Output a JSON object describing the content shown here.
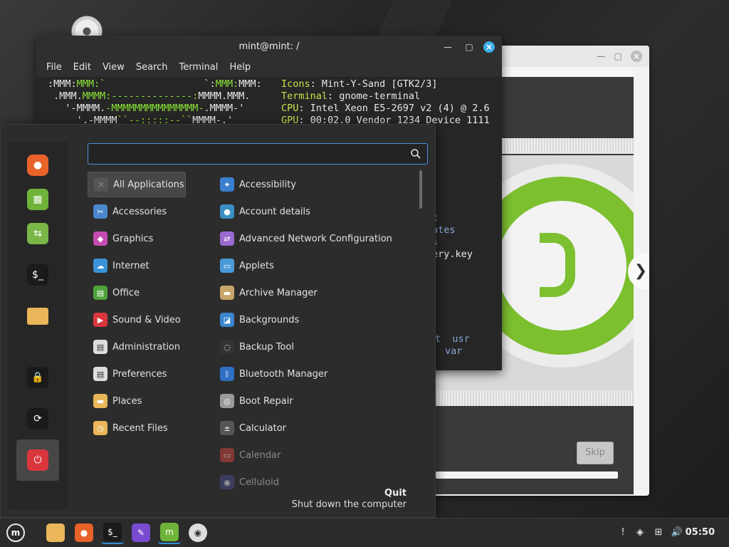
{
  "terminal": {
    "title": "mint@mint: /",
    "menu": [
      "File",
      "Edit",
      "View",
      "Search",
      "Terminal",
      "Help"
    ],
    "lines": [
      {
        "segments": [
          {
            "t": ":MMM:",
            "c": "w"
          },
          {
            "t": "MMM:`",
            "c": "g"
          },
          {
            "t": "                 `:",
            "c": "w"
          },
          {
            "t": "MMM:",
            "c": "g"
          },
          {
            "t": "MMM:",
            "c": "w"
          }
        ]
      },
      {
        "segments": [
          {
            "t": " .MMM.",
            "c": "w"
          },
          {
            "t": "MMMM:--------------:",
            "c": "g"
          },
          {
            "t": "MMMM.MMM.",
            "c": "w"
          }
        ]
      },
      {
        "segments": [
          {
            "t": "   '-MMMM.",
            "c": "w"
          },
          {
            "t": "-MMMMMMMMMMMMMMM-",
            "c": "g"
          },
          {
            "t": ".MMMM-'",
            "c": "w"
          }
        ]
      },
      {
        "segments": [
          {
            "t": "     '.-MMMM",
            "c": "w"
          },
          {
            "t": "``--:::::--``",
            "c": "g"
          },
          {
            "t": "MMMM-.'",
            "c": "w"
          }
        ]
      }
    ],
    "info": [
      {
        "key": "Icons",
        "value": " Mint-Y-Sand [GTK2/3]"
      },
      {
        "key": "Terminal",
        "value": " gnome-terminal"
      },
      {
        "key": "CPU",
        "value": " Intel Xeon E5-2697 v2 (4) @ 2.6"
      },
      {
        "key": "GPU",
        "value": " 00:02.0 Vendor 1234 Device 1111"
      }
    ],
    "fragments": [
      "c",
      "ates",
      "s",
      "ery.key",
      "t  usr",
      "var"
    ]
  },
  "installer": {
    "skip_label": "Skip",
    "next_glyph": "❯"
  },
  "menu": {
    "search_value": "",
    "favorites": [
      {
        "name": "firefox-icon",
        "color": "#e8622a"
      },
      {
        "name": "software-manager-icon",
        "color": "#6fb33a"
      },
      {
        "name": "system-settings-icon",
        "color": "#7ab648"
      },
      {
        "name": "terminal-icon",
        "color": "#1a1a1a"
      },
      {
        "name": "files-icon",
        "color": "#e9b65a"
      },
      {
        "name": "lock-screen-icon",
        "color": "#1a1a1a"
      },
      {
        "name": "logout-icon",
        "color": "#1a1a1a"
      },
      {
        "name": "quit-icon",
        "color": "#d9363e"
      }
    ],
    "categories": [
      {
        "label": "All Applications",
        "icon": "grid-icon",
        "color": "#555555"
      },
      {
        "label": "Accessories",
        "icon": "accessories-icon",
        "color": "#4c86cc"
      },
      {
        "label": "Graphics",
        "icon": "graphics-icon",
        "color": "#c44bb0"
      },
      {
        "label": "Internet",
        "icon": "internet-icon",
        "color": "#3a93d8"
      },
      {
        "label": "Office",
        "icon": "office-icon",
        "color": "#4fa23a"
      },
      {
        "label": "Sound & Video",
        "icon": "sound-video-icon",
        "color": "#d9363e"
      },
      {
        "label": "Administration",
        "icon": "administration-icon",
        "color": "#dddddd"
      },
      {
        "label": "Preferences",
        "icon": "preferences-icon",
        "color": "#dddddd"
      },
      {
        "label": "Places",
        "icon": "places-icon",
        "color": "#e9b65a"
      },
      {
        "label": "Recent Files",
        "icon": "recent-files-icon",
        "color": "#e9b65a"
      }
    ],
    "apps": [
      {
        "label": "Accessibility",
        "icon": "accessibility-icon",
        "color": "#3a7fd0"
      },
      {
        "label": "Account details",
        "icon": "account-details-icon",
        "color": "#3a8ec2"
      },
      {
        "label": "Advanced Network Configuration",
        "icon": "network-config-icon",
        "color": "#9b6ad0"
      },
      {
        "label": "Applets",
        "icon": "applets-icon",
        "color": "#4a9ad8"
      },
      {
        "label": "Archive Manager",
        "icon": "archive-manager-icon",
        "color": "#c7a56a"
      },
      {
        "label": "Backgrounds",
        "icon": "backgrounds-icon",
        "color": "#3c86d0"
      },
      {
        "label": "Backup Tool",
        "icon": "backup-tool-icon",
        "color": "#333333"
      },
      {
        "label": "Bluetooth Manager",
        "icon": "bluetooth-icon",
        "color": "#2f6fc4"
      },
      {
        "label": "Boot Repair",
        "icon": "boot-repair-icon",
        "color": "#9a9a9a"
      },
      {
        "label": "Calculator",
        "icon": "calculator-icon",
        "color": "#555555"
      },
      {
        "label": "Calendar",
        "icon": "calendar-icon",
        "color": "#c9453d",
        "dim": true
      },
      {
        "label": "Celluloid",
        "icon": "celluloid-icon",
        "color": "#4a4a8a",
        "dim": true
      }
    ],
    "quit_title": "Quit",
    "quit_desc": "Shut down the computer"
  },
  "taskbar": {
    "clock": "05:50",
    "items": [
      {
        "name": "mint-menu-button",
        "color": "#2b2b2b"
      },
      {
        "name": "files-icon",
        "color": "#e9b65a"
      },
      {
        "name": "firefox-icon",
        "color": "#e8622a"
      },
      {
        "name": "terminal-icon",
        "color": "#1a1a1a"
      },
      {
        "name": "drawing-icon",
        "color": "#7a4bd0"
      },
      {
        "name": "installer-icon",
        "color": "#6fb33a"
      },
      {
        "name": "disc-icon",
        "color": "#dddddd"
      }
    ],
    "tray": [
      "notifications-icon",
      "shield-icon",
      "network-icon",
      "volume-icon"
    ]
  }
}
